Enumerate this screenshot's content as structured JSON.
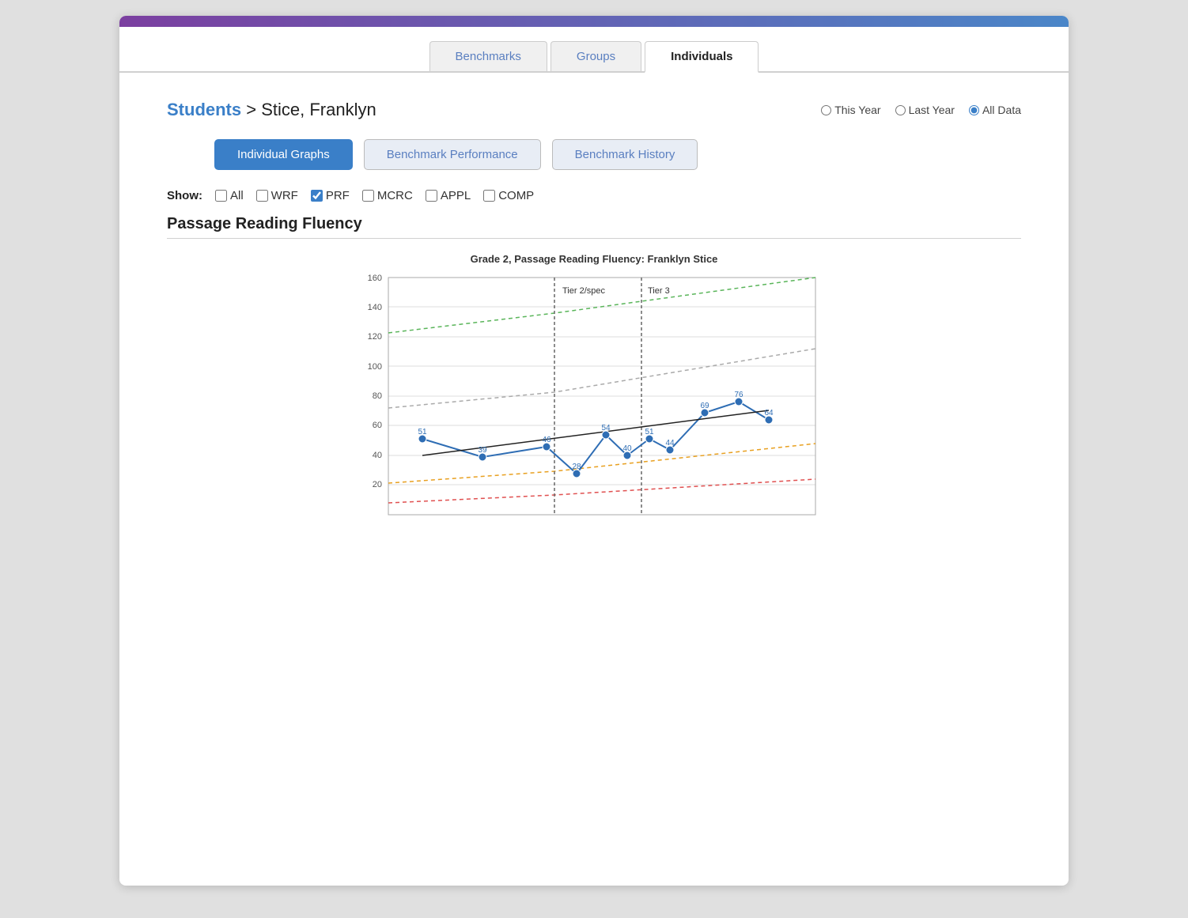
{
  "topbar": {},
  "tabs": [
    {
      "label": "Benchmarks",
      "active": false
    },
    {
      "label": "Groups",
      "active": false
    },
    {
      "label": "Individuals",
      "active": true
    }
  ],
  "breadcrumb": {
    "link_text": "Students",
    "separator": " > ",
    "student_name": "Stice, Franklyn"
  },
  "radio_group": {
    "options": [
      {
        "label": "This Year",
        "value": "this_year",
        "checked": false
      },
      {
        "label": "Last Year",
        "value": "last_year",
        "checked": false
      },
      {
        "label": "All Data",
        "value": "all_data",
        "checked": true
      }
    ]
  },
  "view_buttons": [
    {
      "label": "Individual Graphs",
      "active": true
    },
    {
      "label": "Benchmark Performance",
      "active": false
    },
    {
      "label": "Benchmark History",
      "active": false
    }
  ],
  "show_filters": {
    "label": "Show:",
    "options": [
      {
        "label": "All",
        "checked": false
      },
      {
        "label": "WRF",
        "checked": false
      },
      {
        "label": "PRF",
        "checked": true
      },
      {
        "label": "MCRC",
        "checked": false
      },
      {
        "label": "APPL",
        "checked": false
      },
      {
        "label": "COMP",
        "checked": false
      }
    ]
  },
  "section": {
    "title": "Passage Reading Fluency",
    "chart_title": "Grade 2, Passage Reading Fluency: Franklyn Stice"
  },
  "chart": {
    "y_max": 160,
    "y_ticks": [
      20,
      40,
      60,
      80,
      100,
      120,
      140,
      160
    ],
    "tier_labels": [
      {
        "x": 0.38,
        "label": "Tier 2/spec"
      },
      {
        "x": 0.63,
        "label": "Tier 3"
      }
    ],
    "data_points": [
      {
        "x": 0.08,
        "y": 51
      },
      {
        "x": 0.22,
        "y": 39
      },
      {
        "x": 0.37,
        "y": 46
      },
      {
        "x": 0.44,
        "y": 28
      },
      {
        "x": 0.51,
        "y": 54
      },
      {
        "x": 0.56,
        "y": 40
      },
      {
        "x": 0.61,
        "y": 51
      },
      {
        "x": 0.66,
        "y": 44
      },
      {
        "x": 0.74,
        "y": 69
      },
      {
        "x": 0.82,
        "y": 76
      },
      {
        "x": 0.89,
        "y": 64
      }
    ]
  }
}
